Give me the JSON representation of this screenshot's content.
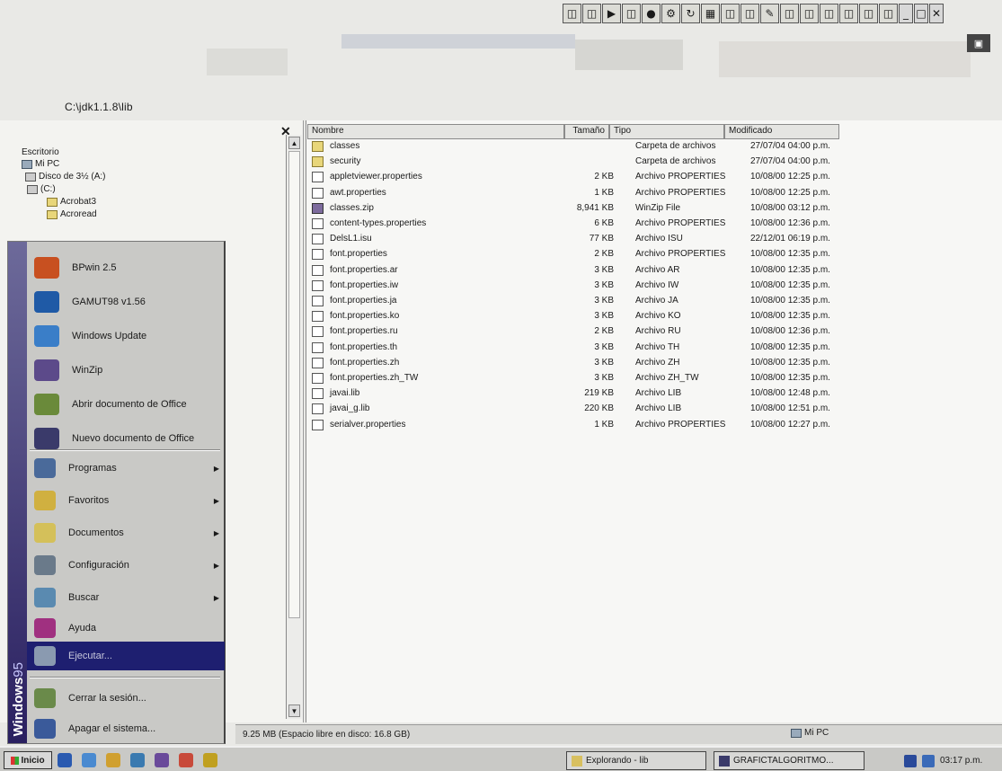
{
  "toolbar": {
    "icons": [
      "pin-icon",
      "pin-icon",
      "play-icon",
      "pin-icon",
      "record-icon",
      "gear-icon",
      "loop-icon",
      "grid-icon",
      "pin-icon",
      "pin-icon",
      "edit-icon",
      "pin-icon",
      "pin-icon",
      "pin-icon",
      "pin-icon",
      "pin-icon",
      "pin-icon"
    ],
    "window_controls": [
      "_",
      "□",
      "✕"
    ]
  },
  "address_bar": {
    "path": "C:\\jdk1.1.8\\lib"
  },
  "tree_pane": {
    "close_glyph": "✕",
    "nodes": [
      {
        "label": "Escritorio",
        "icon": "desktop-icon",
        "kind": "none"
      },
      {
        "label": "Mi PC",
        "icon": "computer-icon",
        "kind": "pc"
      },
      {
        "label": "Disco de 3½ (A:)",
        "icon": "floppy-icon",
        "kind": "drv"
      },
      {
        "label": "(C:)",
        "icon": "hard-drive-icon",
        "kind": "drv"
      },
      {
        "label": "Acrobat3",
        "icon": "folder-icon",
        "kind": "fold"
      },
      {
        "label": "Acroread",
        "icon": "folder-icon",
        "kind": "fold"
      }
    ]
  },
  "start_menu": {
    "banner": {
      "bold": "Windows",
      "light": "95"
    },
    "top_items": [
      {
        "label": "BPwin 2.5",
        "icon": "crosshair-icon",
        "color": "#c85020"
      },
      {
        "label": "GAMUT98 v1.56",
        "icon": "gamut-icon",
        "color": "#1f5aa6"
      },
      {
        "label": "Windows Update",
        "icon": "globe-icon",
        "color": "#3a7ec8"
      },
      {
        "label": "WinZip",
        "icon": "winzip-icon",
        "color": "#5c4a8a"
      },
      {
        "label": "Abrir documento de Office",
        "icon": "open-document-icon",
        "color": "#6a8a3a"
      },
      {
        "label": "Nuevo documento de Office",
        "icon": "new-document-icon",
        "color": "#3a3a6a"
      }
    ],
    "items": [
      {
        "label": "Programas",
        "icon": "programs-icon",
        "color": "#4a6a9a",
        "submenu": true
      },
      {
        "label": "Favoritos",
        "icon": "favorites-icon",
        "color": "#d0b040",
        "submenu": true
      },
      {
        "label": "Documentos",
        "icon": "documents-icon",
        "color": "#d4c05a",
        "submenu": true
      },
      {
        "label": "Configuración",
        "icon": "settings-icon",
        "color": "#6a7a8a",
        "submenu": true
      },
      {
        "label": "Buscar",
        "icon": "search-icon",
        "color": "#5a8ab0",
        "submenu": true
      },
      {
        "label": "Ayuda",
        "icon": "help-icon",
        "color": "#a03080",
        "submenu": false
      },
      {
        "label": "Ejecutar...",
        "icon": "run-icon",
        "color": "#8a9ab0",
        "submenu": false,
        "active": true
      },
      {
        "label": "Cerrar la sesión...",
        "icon": "logoff-icon",
        "color": "#6a8a4a",
        "submenu": false
      },
      {
        "label": "Apagar el sistema...",
        "icon": "shutdown-icon",
        "color": "#3a5a9a",
        "submenu": false
      }
    ]
  },
  "file_list": {
    "columns": [
      "Nombre",
      "Tamaño",
      "Tipo",
      "Modificado"
    ],
    "rows": [
      {
        "name": "classes",
        "size": "",
        "type": "Carpeta de archivos",
        "modified": "27/07/04 04:00 p.m.",
        "kind": "folder"
      },
      {
        "name": "security",
        "size": "",
        "type": "Carpeta de archivos",
        "modified": "27/07/04 04:00 p.m.",
        "kind": "folder"
      },
      {
        "name": "appletviewer.properties",
        "size": "2 KB",
        "type": "Archivo PROPERTIES",
        "modified": "10/08/00 12:25 p.m.",
        "kind": "prop"
      },
      {
        "name": "awt.properties",
        "size": "1 KB",
        "type": "Archivo PROPERTIES",
        "modified": "10/08/00 12:25 p.m.",
        "kind": "prop"
      },
      {
        "name": "classes.zip",
        "size": "8,941 KB",
        "type": "WinZip File",
        "modified": "10/08/00 03:12 p.m.",
        "kind": "zip"
      },
      {
        "name": "content-types.properties",
        "size": "6 KB",
        "type": "Archivo PROPERTIES",
        "modified": "10/08/00 12:36 p.m.",
        "kind": "prop"
      },
      {
        "name": "DelsL1.isu",
        "size": "77 KB",
        "type": "Archivo ISU",
        "modified": "22/12/01 06:19 p.m.",
        "kind": "prop"
      },
      {
        "name": "font.properties",
        "size": "2 KB",
        "type": "Archivo PROPERTIES",
        "modified": "10/08/00 12:35 p.m.",
        "kind": "prop"
      },
      {
        "name": "font.properties.ar",
        "size": "3 KB",
        "type": "Archivo AR",
        "modified": "10/08/00 12:35 p.m.",
        "kind": "prop"
      },
      {
        "name": "font.properties.iw",
        "size": "3 KB",
        "type": "Archivo IW",
        "modified": "10/08/00 12:35 p.m.",
        "kind": "prop"
      },
      {
        "name": "font.properties.ja",
        "size": "3 KB",
        "type": "Archivo JA",
        "modified": "10/08/00 12:35 p.m.",
        "kind": "prop"
      },
      {
        "name": "font.properties.ko",
        "size": "3 KB",
        "type": "Archivo KO",
        "modified": "10/08/00 12:35 p.m.",
        "kind": "prop"
      },
      {
        "name": "font.properties.ru",
        "size": "2 KB",
        "type": "Archivo RU",
        "modified": "10/08/00 12:36 p.m.",
        "kind": "prop"
      },
      {
        "name": "font.properties.th",
        "size": "3 KB",
        "type": "Archivo TH",
        "modified": "10/08/00 12:35 p.m.",
        "kind": "prop"
      },
      {
        "name": "font.properties.zh",
        "size": "3 KB",
        "type": "Archivo ZH",
        "modified": "10/08/00 12:35 p.m.",
        "kind": "prop"
      },
      {
        "name": "font.properties.zh_TW",
        "size": "3 KB",
        "type": "Archivo ZH_TW",
        "modified": "10/08/00 12:35 p.m.",
        "kind": "prop"
      },
      {
        "name": "javai.lib",
        "size": "219 KB",
        "type": "Archivo LIB",
        "modified": "10/08/00 12:48 p.m.",
        "kind": "prop"
      },
      {
        "name": "javai_g.lib",
        "size": "220 KB",
        "type": "Archivo LIB",
        "modified": "10/08/00 12:51 p.m.",
        "kind": "prop"
      },
      {
        "name": "serialver.properties",
        "size": "1 KB",
        "type": "Archivo PROPERTIES",
        "modified": "10/08/00 12:27 p.m.",
        "kind": "prop"
      }
    ]
  },
  "status_bar": {
    "text": "9.25 MB (Espacio libre en disco: 16.8 GB)",
    "location": "Mi PC"
  },
  "taskbar": {
    "start_label": "Inicio",
    "quick_launch": [
      "browser-icon",
      "email-icon",
      "channels-icon",
      "desktop-icon",
      "explorer-icon",
      "winzip-icon",
      "arrow-icon"
    ],
    "tasks": [
      {
        "label": "Explorando - lib",
        "icon": "explorer-icon"
      },
      {
        "label": "GRAFICTALGORITMO...",
        "icon": "document-icon"
      }
    ],
    "clock": "03:17 p.m."
  }
}
